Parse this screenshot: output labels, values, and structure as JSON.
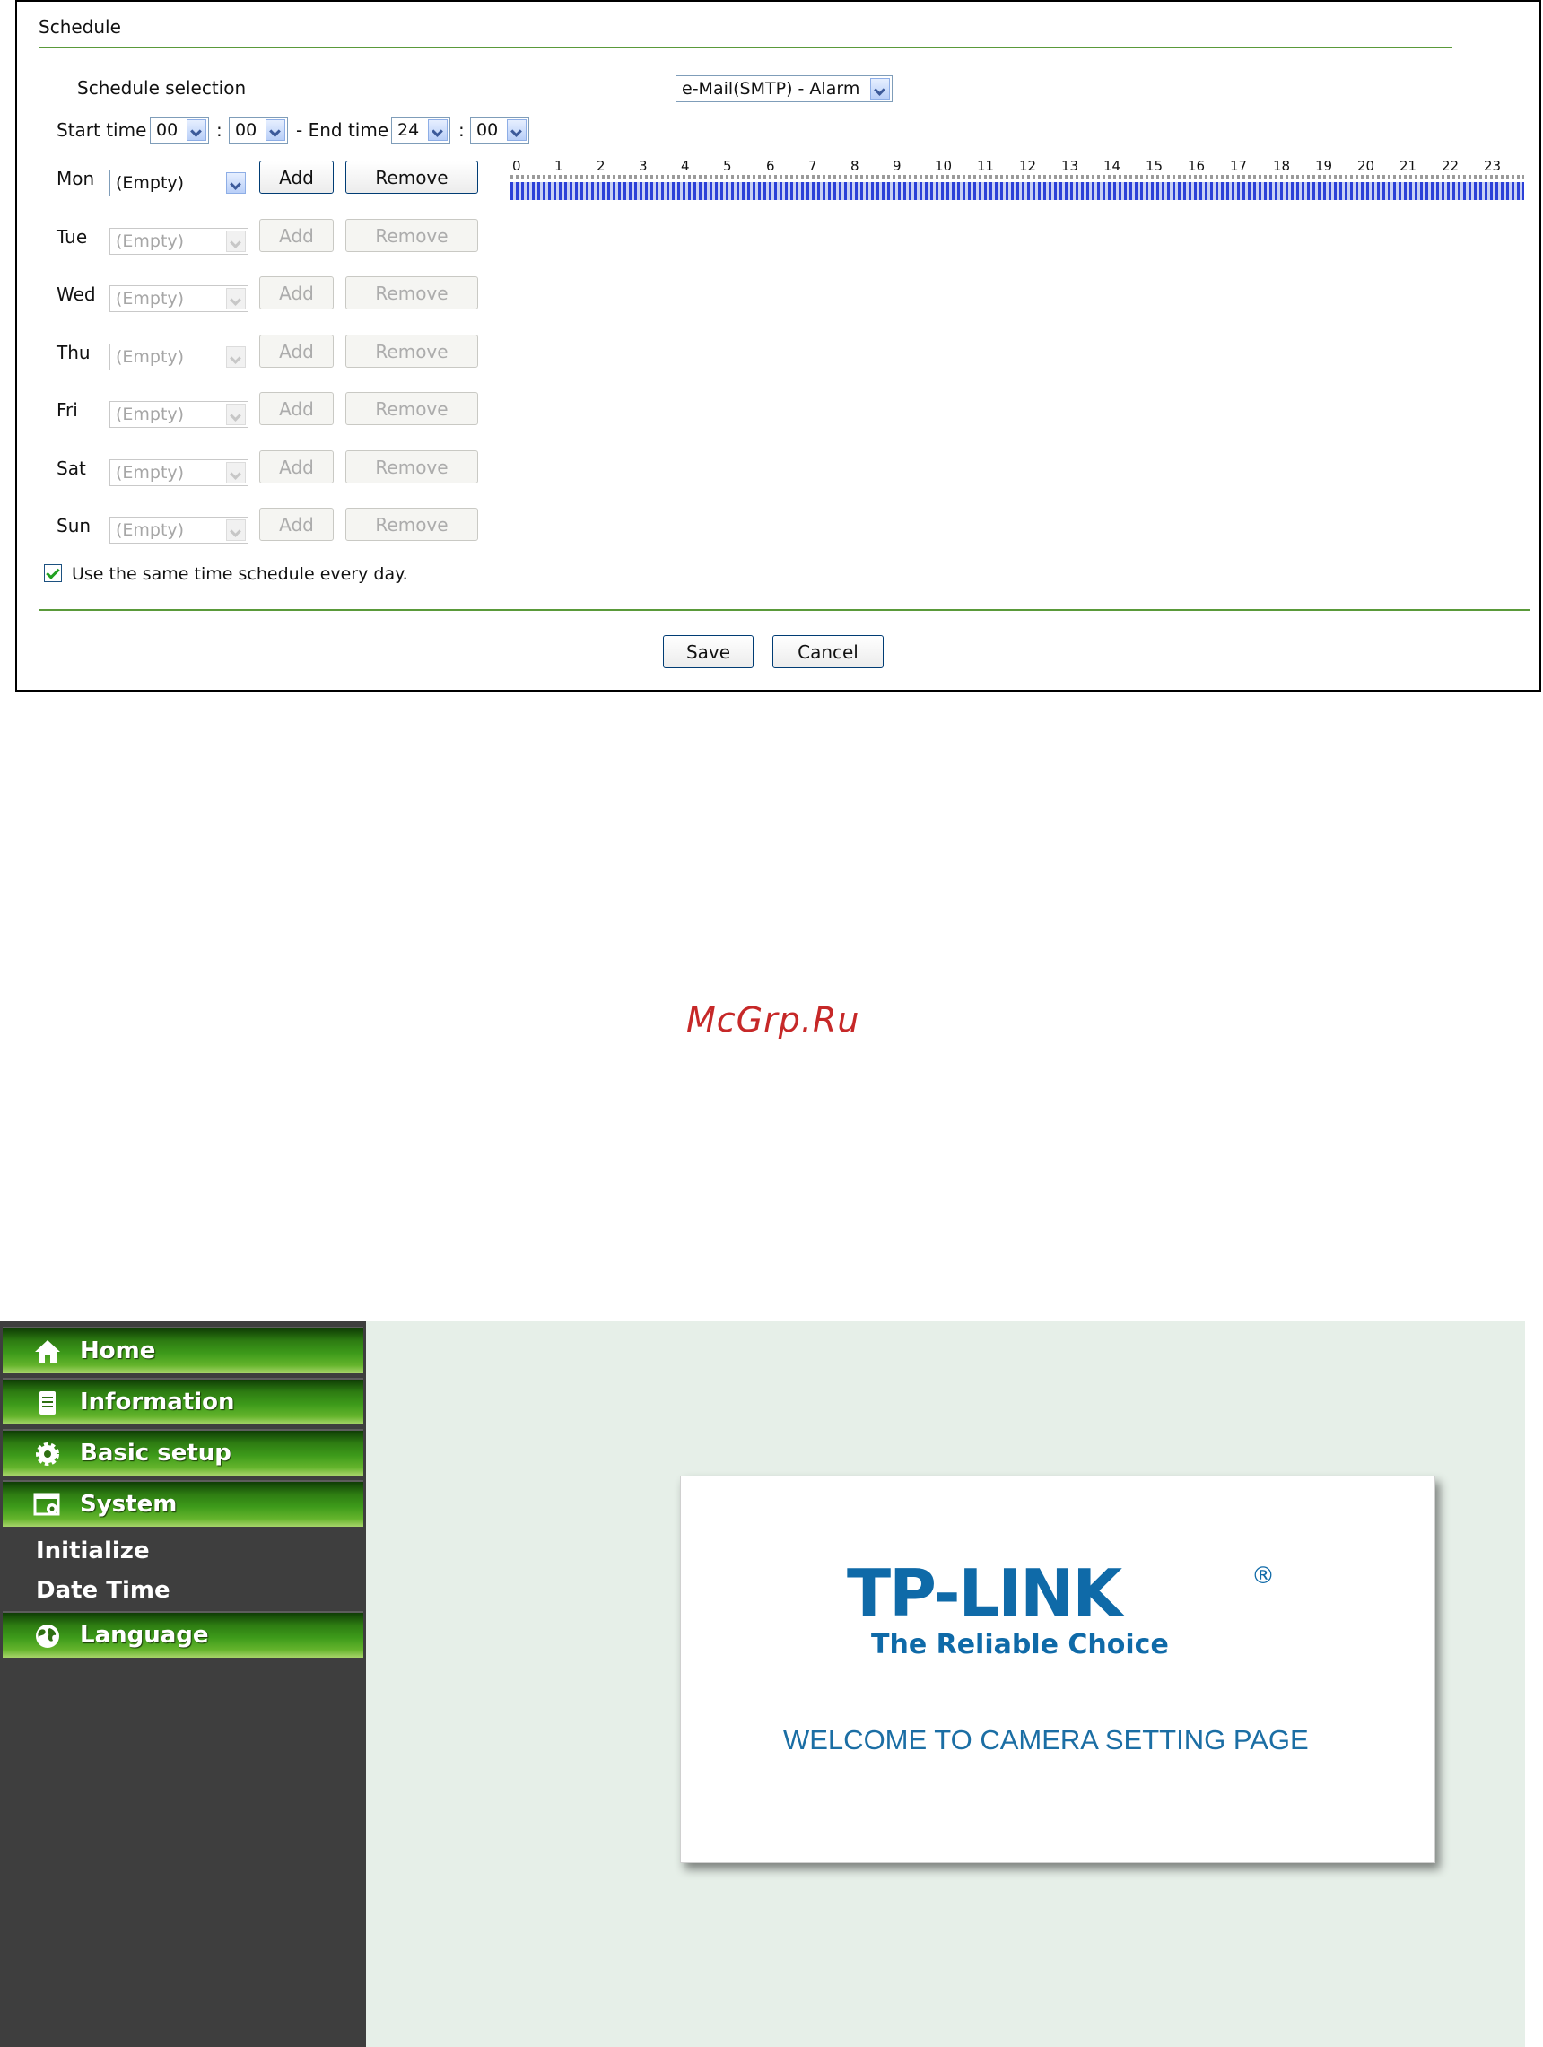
{
  "schedule": {
    "title": "Schedule",
    "selection_label": "Schedule selection",
    "selection_value": "e-Mail(SMTP) - Alarm",
    "start_label": "Start time",
    "start_hour": "00",
    "start_min": "00",
    "end_label": "- End time",
    "end_hour": "24",
    "end_min": "00",
    "colon": ":",
    "hours": [
      "0",
      "1",
      "2",
      "3",
      "4",
      "5",
      "6",
      "7",
      "8",
      "9",
      "10",
      "11",
      "12",
      "13",
      "14",
      "15",
      "16",
      "17",
      "18",
      "19",
      "20",
      "21",
      "22",
      "23"
    ],
    "days": [
      {
        "label": "Mon",
        "value": "(Empty)",
        "enabled": true
      },
      {
        "label": "Tue",
        "value": "(Empty)",
        "enabled": false
      },
      {
        "label": "Wed",
        "value": "(Empty)",
        "enabled": false
      },
      {
        "label": "Thu",
        "value": "(Empty)",
        "enabled": false
      },
      {
        "label": "Fri",
        "value": "(Empty)",
        "enabled": false
      },
      {
        "label": "Sat",
        "value": "(Empty)",
        "enabled": false
      },
      {
        "label": "Sun",
        "value": "(Empty)",
        "enabled": false
      }
    ],
    "add_label": "Add",
    "remove_label": "Remove",
    "same_schedule_label": "Use the same time schedule every day.",
    "same_schedule_checked": true,
    "save_label": "Save",
    "cancel_label": "Cancel",
    "timeline_color": "#2b40d8",
    "accent_color": "#5a9a3a"
  },
  "watermark": "McGrp.Ru",
  "camera": {
    "nav": [
      {
        "label": "Home",
        "icon": "home-icon"
      },
      {
        "label": "Information",
        "icon": "document-icon"
      },
      {
        "label": "Basic setup",
        "icon": "gear-icon"
      },
      {
        "label": "System",
        "icon": "system-window-icon"
      },
      {
        "label": "Language",
        "icon": "globe-icon"
      }
    ],
    "system_sub": [
      "Initialize",
      "Date Time"
    ],
    "logo_text": "TP-LINK",
    "logo_mark": "®",
    "tagline": "The Reliable Choice",
    "welcome": "WELCOME TO CAMERA SETTING PAGE",
    "brand_color": "#0f6aa8"
  }
}
